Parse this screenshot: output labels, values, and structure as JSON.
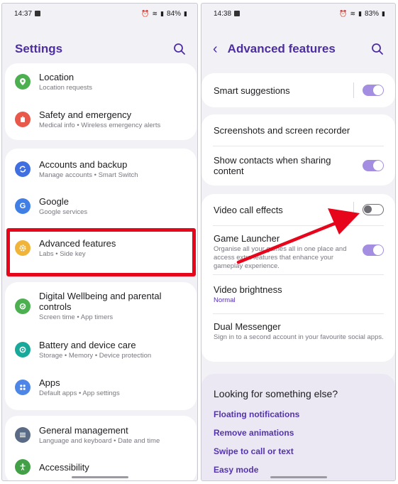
{
  "left": {
    "status": {
      "time": "14:37",
      "battery": "84%"
    },
    "header": {
      "title": "Settings"
    },
    "items": [
      {
        "title": "Location",
        "sub": "Location requests",
        "color": "#4caf50"
      },
      {
        "title": "Safety and emergency",
        "sub": "Medical info  •  Wireless emergency alerts",
        "color": "#e8594b"
      },
      {
        "title": "Accounts and backup",
        "sub": "Manage accounts  •  Smart Switch",
        "color": "#3f6fe0"
      },
      {
        "title": "Google",
        "sub": "Google services",
        "color": "#3f7fe6"
      },
      {
        "title": "Advanced features",
        "sub": "Labs  •  Side key",
        "color": "#f0b43a"
      },
      {
        "title": "Digital Wellbeing and parental controls",
        "sub": "Screen time  •  App timers",
        "color": "#4caf50"
      },
      {
        "title": "Battery and device care",
        "sub": "Storage  •  Memory  •  Device protection",
        "color": "#19a99a"
      },
      {
        "title": "Apps",
        "sub": "Default apps  •  App settings",
        "color": "#4e86e8"
      },
      {
        "title": "General management",
        "sub": "Language and keyboard  •  Date and time",
        "color": "#5a6b85"
      },
      {
        "title": "Accessibility",
        "sub": "",
        "color": "#43a047"
      }
    ]
  },
  "right": {
    "status": {
      "time": "14:38",
      "battery": "83%"
    },
    "header": {
      "title": "Advanced features"
    },
    "smart": {
      "title": "Smart suggestions",
      "on": true
    },
    "screenshots": {
      "title": "Screenshots and screen recorder"
    },
    "contacts": {
      "title": "Show contacts when sharing content",
      "on": true
    },
    "video_call": {
      "title": "Video call effects",
      "on": false
    },
    "game": {
      "title": "Game Launcher",
      "sub": "Organise all your games all in one place and access extra features that enhance your gameplay experience.",
      "on": true
    },
    "brightness": {
      "title": "Video brightness",
      "value": "Normal"
    },
    "dual": {
      "title": "Dual Messenger",
      "sub": "Sign in to a second account in your favourite social apps."
    },
    "looking": {
      "title": "Looking for something else?",
      "links": [
        "Floating notifications",
        "Remove animations",
        "Swipe to call or text",
        "Easy mode"
      ]
    }
  },
  "colors": {
    "accent": "#4d2ea1",
    "toggle_on": "#a48ee2",
    "highlight": "#e6051a",
    "arrow": "#e6051a"
  }
}
